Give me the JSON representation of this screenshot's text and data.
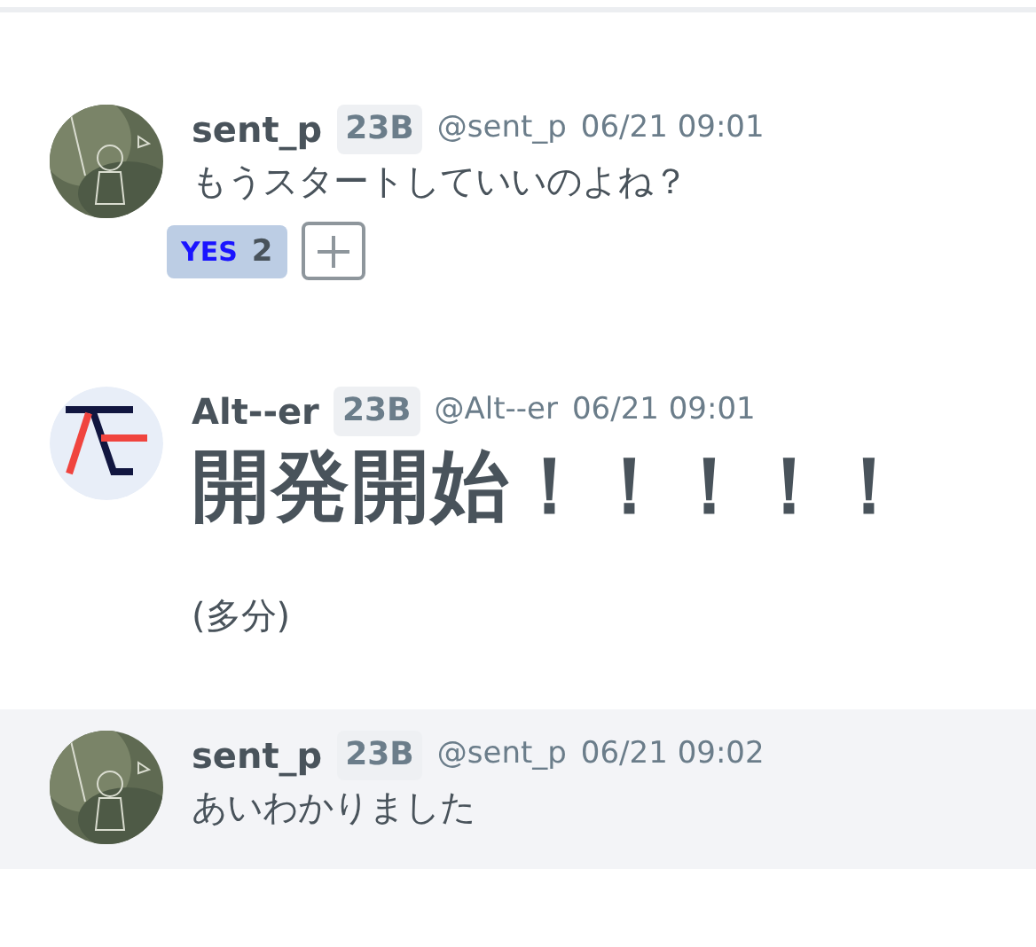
{
  "messages": [
    {
      "kind": "picture",
      "name": "sent_p",
      "grade": "23B",
      "handle": "@sent_p",
      "time": "06/21 09:01",
      "highlighted": false,
      "body": [
        {
          "kind": "text",
          "text": "もうスタートしていいのよね？"
        }
      ],
      "reactions": [
        {
          "label": "YES",
          "count": "2",
          "selected": true
        }
      ]
    },
    {
      "kind": "logo",
      "name": "Alt--er",
      "grade": "23B",
      "handle": "@Alt--er",
      "time": "06/21 09:01",
      "highlighted": false,
      "body": [
        {
          "kind": "heading",
          "text": "開発開始！！！！！"
        },
        {
          "kind": "text",
          "text": "(多分)"
        }
      ]
    },
    {
      "kind": "picture",
      "name": "sent_p",
      "grade": "23B",
      "handle": "@sent_p",
      "time": "06/21 09:02",
      "highlighted": true,
      "body": [
        {
          "kind": "text",
          "text": "あいわかりました"
        }
      ]
    }
  ]
}
